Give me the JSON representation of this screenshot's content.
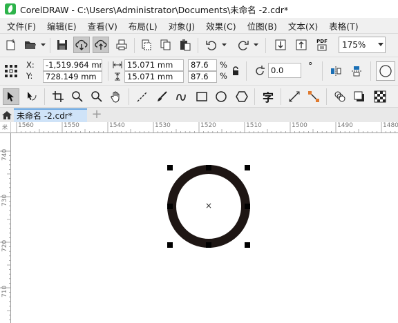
{
  "window": {
    "title": "CorelDRAW - C:\\Users\\Administrator\\Documents\\未命名 -2.cdr*"
  },
  "menu": [
    "文件(F)",
    "编辑(E)",
    "查看(V)",
    "布局(L)",
    "对象(J)",
    "效果(C)",
    "位图(B)",
    "文本(X)",
    "表格(T)"
  ],
  "toolbar": {
    "zoom_value": "175%",
    "pdf_label": "PDF"
  },
  "property_bar": {
    "x_label": "X:",
    "y_label": "Y:",
    "x_value": "-1,519.964 mm",
    "y_value": "728.149 mm",
    "width_value": "15.071 mm",
    "height_value": "15.071 mm",
    "scale_w": "87.6",
    "scale_h": "87.6",
    "percent": "%",
    "rotation_value": "0.0",
    "degree": "°"
  },
  "toolbox": {
    "text_tool_glyph": "字"
  },
  "tabs": {
    "document_tab": "未命名 -2.cdr*",
    "add_tab": "+"
  },
  "rulers": {
    "horizontal": [
      "1560",
      "1550",
      "1540",
      "1530",
      "1520",
      "1510",
      "1500",
      "1490",
      "1480"
    ],
    "vertical": [
      "740",
      "730",
      "720",
      "710"
    ],
    "unit_label": "米"
  },
  "canvas": {
    "center_marker": "×",
    "ring_color": "#1e1614"
  }
}
